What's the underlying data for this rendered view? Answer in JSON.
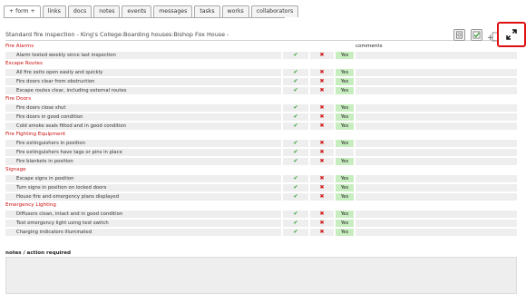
{
  "tabs": [
    "+ form +",
    "links",
    "docs",
    "notes",
    "events",
    "messages",
    "tasks",
    "works",
    "collaborators"
  ],
  "form": {
    "title": "Standard fire inspection - King's College:Boarding houses:Bishop Fox House -",
    "comments_header": "comments",
    "notes_label": "notes / action required"
  },
  "marks": {
    "yes": "✔",
    "no": "✖"
  },
  "icons": {
    "tool_1": "note-icon",
    "tool_2": "checkbox-icon",
    "add": "add-icon",
    "expand": "expand-icon"
  },
  "colors": {
    "section": "#cc1111",
    "yes": "#2e9a2e",
    "no": "#d01818",
    "answer_fill": "#c8edc0",
    "highlight": "#e01010"
  },
  "sections": [
    {
      "title": "Fire Alarms",
      "items": [
        {
          "label": "Alarm tested weekly since last inspection",
          "value": "Yes"
        }
      ]
    },
    {
      "title": "Escape Routes",
      "items": [
        {
          "label": "All fire exits open easily and quickly",
          "value": "Yes"
        },
        {
          "label": "Fire doors clear from obstruction",
          "value": "Yes"
        },
        {
          "label": "Escape routes clear, including external routes",
          "value": "Yes"
        }
      ]
    },
    {
      "title": "Fire Doors",
      "items": [
        {
          "label": "Fire doors close shut",
          "value": "Yes"
        },
        {
          "label": "Fire doors in good condition",
          "value": "Yes"
        },
        {
          "label": "Cold smoke seals fitted and in good condition",
          "value": "Yes"
        }
      ]
    },
    {
      "title": "Fire Fighting Equipment",
      "items": [
        {
          "label": "Fire extinguishers in position",
          "value": "Yes"
        },
        {
          "label": "Fire extinguishers have tags or pins in place",
          "value": ""
        },
        {
          "label": "Fire blankets in position",
          "value": "Yes"
        }
      ]
    },
    {
      "title": "Signage",
      "items": [
        {
          "label": "Escape signs in position",
          "value": "Yes"
        },
        {
          "label": "Turn signs in position on locked doors",
          "value": "Yes"
        },
        {
          "label": "House fire and emergency plans displayed",
          "value": "Yes"
        }
      ]
    },
    {
      "title": "Emergency Lighting",
      "items": [
        {
          "label": "Diffusers clean, intact and in good condition",
          "value": "Yes"
        },
        {
          "label": "Test emergency light using test switch",
          "value": "Yes"
        },
        {
          "label": "Charging indicators illuminated",
          "value": "Yes"
        }
      ]
    }
  ]
}
